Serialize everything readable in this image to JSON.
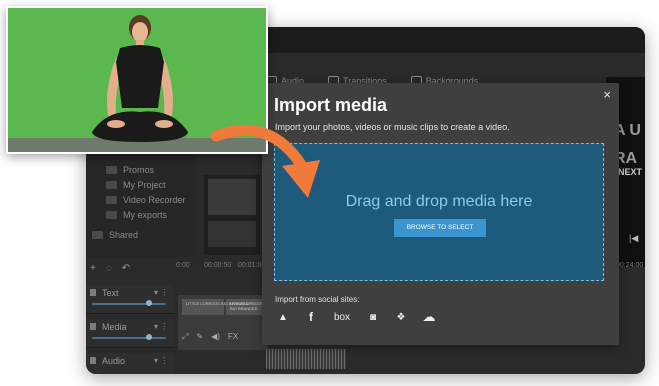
{
  "editor": {
    "tabs": [
      {
        "label": "Audio"
      },
      {
        "label": "Transitions"
      },
      {
        "label": "Backgrounds"
      }
    ],
    "folders": [
      {
        "label": "Promos"
      },
      {
        "label": "My Project"
      },
      {
        "label": "Video Recorder"
      },
      {
        "label": "My exports"
      }
    ],
    "shared_label": "Shared",
    "preview": {
      "letters_1": "A U",
      "letters_2": "RA",
      "next": "NEXT"
    },
    "timeline": {
      "ruler": [
        "0:00",
        "00:00:50",
        "00:01:00",
        "00:24:00"
      ],
      "tracks": [
        {
          "label": "Text"
        },
        {
          "label": "Media"
        },
        {
          "label": "Audio"
        }
      ],
      "clip_caption": "LITTLE LOREDOS BIG BRANDED"
    }
  },
  "dialog": {
    "title": "Import media",
    "subtitle": "Import your photos, videos or music clips to create a video.",
    "close": "×",
    "drop_text": "Drag and drop media here",
    "browse_button": "BROWSE TO SELECT",
    "social_label": "Import from social sites:",
    "social_icons": [
      {
        "name": "google-drive-icon",
        "glyph": "▲"
      },
      {
        "name": "facebook-icon",
        "glyph": "f"
      },
      {
        "name": "box-icon",
        "glyph": "box"
      },
      {
        "name": "instagram-icon",
        "glyph": "◙"
      },
      {
        "name": "dropbox-icon",
        "glyph": "❖"
      },
      {
        "name": "onedrive-icon",
        "glyph": "☁"
      }
    ]
  },
  "colors": {
    "accent": "#3a95cf",
    "drop_zone": "#1e5a7b",
    "green_screen": "#5bb84e",
    "arrow": "#f07a3a"
  }
}
